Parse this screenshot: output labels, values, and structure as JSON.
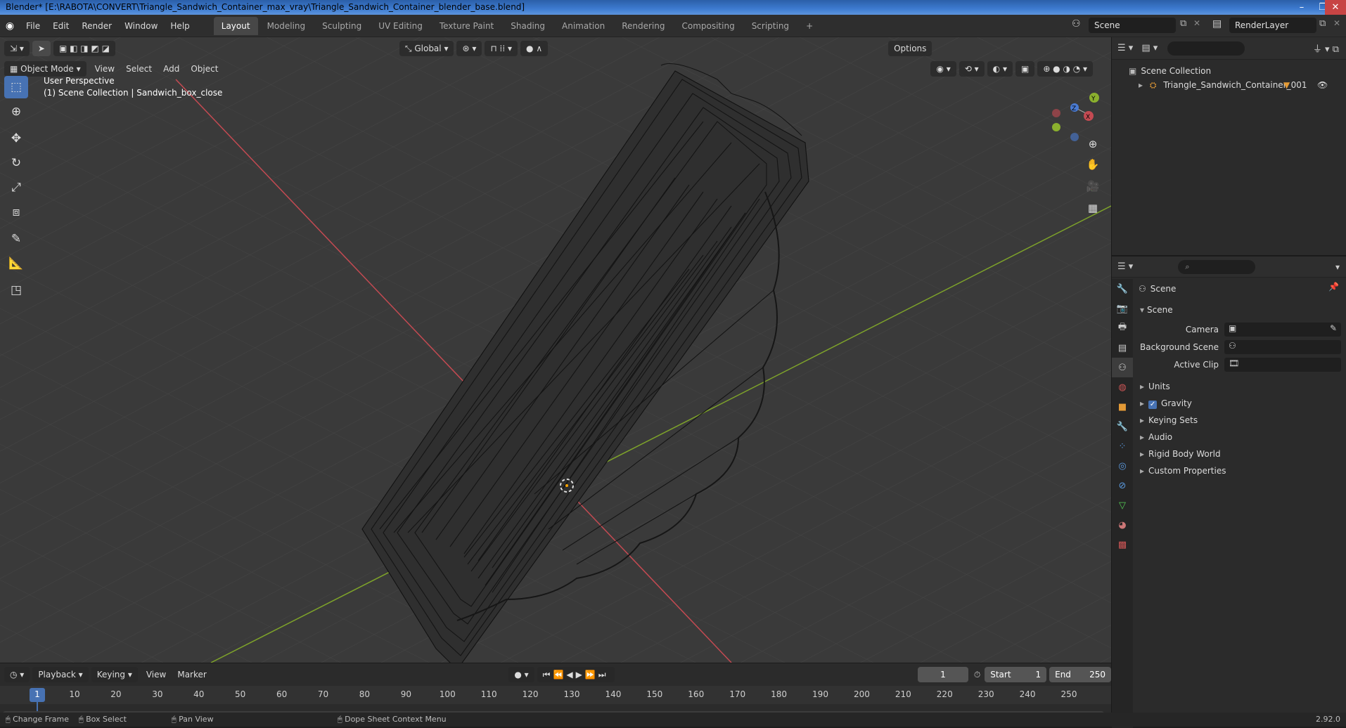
{
  "window": {
    "title": "Blender* [E:\\RABOTA\\CONVERT\\Triangle_Sandwich_Container_max_vray\\Triangle_Sandwich_Container_blender_base.blend]",
    "minimize": "–",
    "maximize": "❐",
    "close": "✕"
  },
  "menu": [
    "File",
    "Edit",
    "Render",
    "Window",
    "Help"
  ],
  "workspaces": [
    "Layout",
    "Modeling",
    "Sculpting",
    "UV Editing",
    "Texture Paint",
    "Shading",
    "Animation",
    "Rendering",
    "Compositing",
    "Scripting"
  ],
  "active_workspace": "Layout",
  "add_workspace": "+",
  "scene_field": "Scene",
  "render_layer_field": "RenderLayer",
  "viewport": {
    "mode": "Object Mode",
    "menus": [
      "View",
      "Select",
      "Add",
      "Object"
    ],
    "orientation": "Global",
    "options": "Options",
    "perspective_label": "User Perspective",
    "collection_label": "(1) Scene Collection | Sandwich_box_close",
    "axis_x": "X",
    "axis_y": "Y",
    "axis_z": "Z"
  },
  "outliner": {
    "search_placeholder": "",
    "root": "Scene Collection",
    "items": [
      "Triangle_Sandwich_Container_001"
    ]
  },
  "properties": {
    "context": "Scene",
    "section": "Scene",
    "fields": [
      {
        "label": "Camera",
        "value": ""
      },
      {
        "label": "Background Scene",
        "value": ""
      },
      {
        "label": "Active Clip",
        "value": ""
      }
    ],
    "panels": [
      "Units",
      "Gravity",
      "Keying Sets",
      "Audio",
      "Rigid Body World",
      "Custom Properties"
    ],
    "gravity_enabled": true
  },
  "timeline": {
    "menus": [
      "Playback",
      "Keying",
      "View",
      "Marker"
    ],
    "current_frame": "1",
    "start_label": "Start",
    "start": "1",
    "end_label": "End",
    "end": "250",
    "ticks": [
      "1",
      "10",
      "20",
      "30",
      "40",
      "50",
      "60",
      "70",
      "80",
      "90",
      "100",
      "110",
      "120",
      "130",
      "140",
      "150",
      "160",
      "170",
      "180",
      "190",
      "200",
      "210",
      "220",
      "230",
      "240",
      "250"
    ]
  },
  "status": {
    "items": [
      "Change Frame",
      "Box Select",
      "Pan View",
      "Dope Sheet Context Menu"
    ],
    "version": "2.92.0"
  },
  "colors": {
    "accent": "#4772b3",
    "x_axis": "#c44a52",
    "y_axis": "#8bb02e",
    "viewport_bg": "#3a3a3a"
  }
}
